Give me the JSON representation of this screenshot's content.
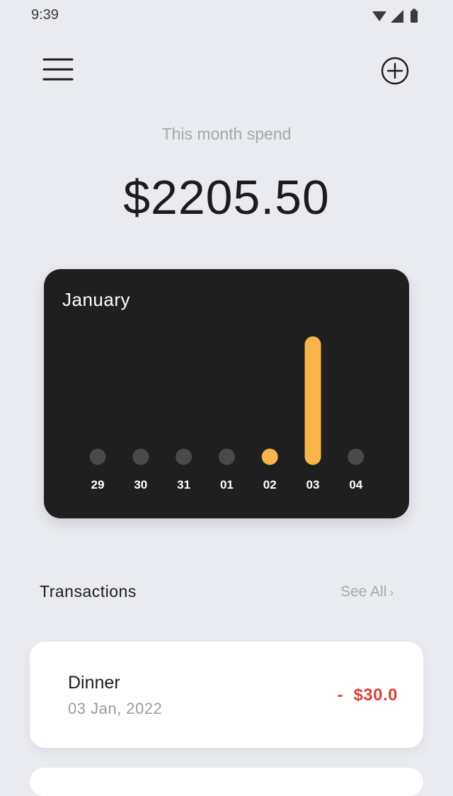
{
  "status_bar": {
    "time": "9:39",
    "icons": [
      "wifi-icon",
      "signal-icon",
      "battery-icon"
    ]
  },
  "header": {
    "menu_icon": "hamburger-menu-icon",
    "add_icon": "plus-circle-icon"
  },
  "summary": {
    "label": "This month spend",
    "amount": "$2205.50"
  },
  "chart_data": {
    "type": "bar",
    "title": "January",
    "categories": [
      "29",
      "30",
      "31",
      "01",
      "02",
      "03",
      "04"
    ],
    "series": [
      {
        "values": [
          0,
          0,
          0,
          0,
          1,
          10,
          0
        ]
      }
    ],
    "colors": {
      "active": "#f9b54c",
      "inactive": "#4a4a4c",
      "label": "#ffffff",
      "background": "#1f1f20"
    }
  },
  "transactions": {
    "title": "Transactions",
    "see_all": "See All",
    "see_all_icon": "chevron-right-icon",
    "items": [
      {
        "name": "Dinner",
        "date": "03 Jan, 2022",
        "amount": "-  $30.0",
        "amount_color": "#d64537"
      }
    ]
  },
  "colors": {
    "background": "#e9ebf0",
    "card": "#ffffff",
    "accent": "#f9b54c",
    "negative": "#d64537"
  }
}
